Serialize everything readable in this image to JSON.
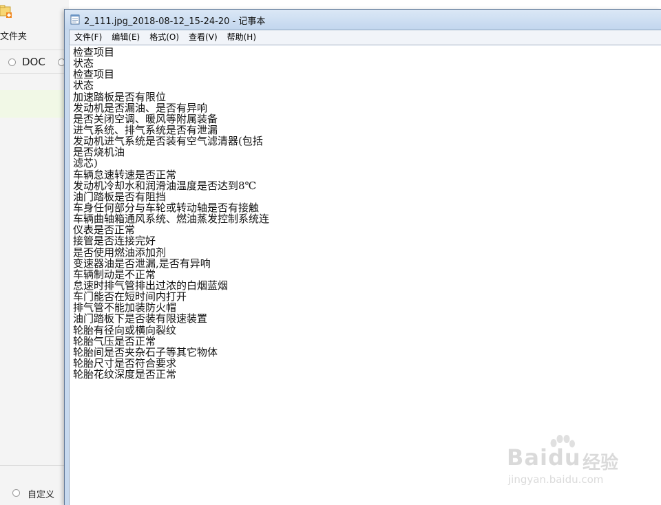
{
  "background_app": {
    "new_folder_label": "文件夹",
    "format_option_label": "DOC",
    "custom_option_label": "自定义"
  },
  "window": {
    "title": "2_111.jpg_2018-08-12_15-24-20 - 记事本",
    "menu": [
      {
        "label": "文件(F)"
      },
      {
        "label": "编辑(E)"
      },
      {
        "label": "格式(O)"
      },
      {
        "label": "查看(V)"
      },
      {
        "label": "帮助(H)"
      }
    ],
    "lines": [
      "检查项目",
      "状态",
      "检查项目",
      "状态",
      "加速踏板是否有限位",
      "发动机是否漏油、是否有异响",
      "是否关闭空调、暖风等附属装备",
      "进气系统、排气系统是否有泄漏",
      "发动机进气系统是否装有空气滤清器(包括",
      "是否烧机油",
      "滤芯)",
      "车辆怠速转速是否正常",
      "发动机冷却水和润滑油温度是否达到8℃",
      "油门踏板是否有阻挡",
      "车身任何部分与车轮或转动轴是否有接触",
      "车辆曲轴箱通风系统、燃油蒸发控制系统连",
      "仪表是否正常",
      "接管是否连接完好",
      "是否使用燃油添加剂",
      "变速器油是否泄漏,是否有异响",
      "车辆制动是不正常",
      "怠速时排气管排出过浓的白烟蓝烟",
      "车门能否在短时间内打开",
      "排气管不能加装防火帽",
      "油门踏板下是否装有限速装置",
      "轮胎有径向或横向裂纹",
      "轮胎气压是否正常",
      "轮胎间是否夹杂石子等其它物体",
      "轮胎尺寸是否符合要求",
      "轮胎花纹深度是否正常"
    ]
  },
  "watermark": {
    "brand": "Baidu",
    "brand_cn": "经验",
    "url": "jingyan.baidu.com"
  },
  "colors": {
    "titlebar": "#c7d9ee",
    "menubar": "#f1f4f9",
    "editor_bg": "#ffffff",
    "selected_row_bg": "#f1f8e6"
  }
}
